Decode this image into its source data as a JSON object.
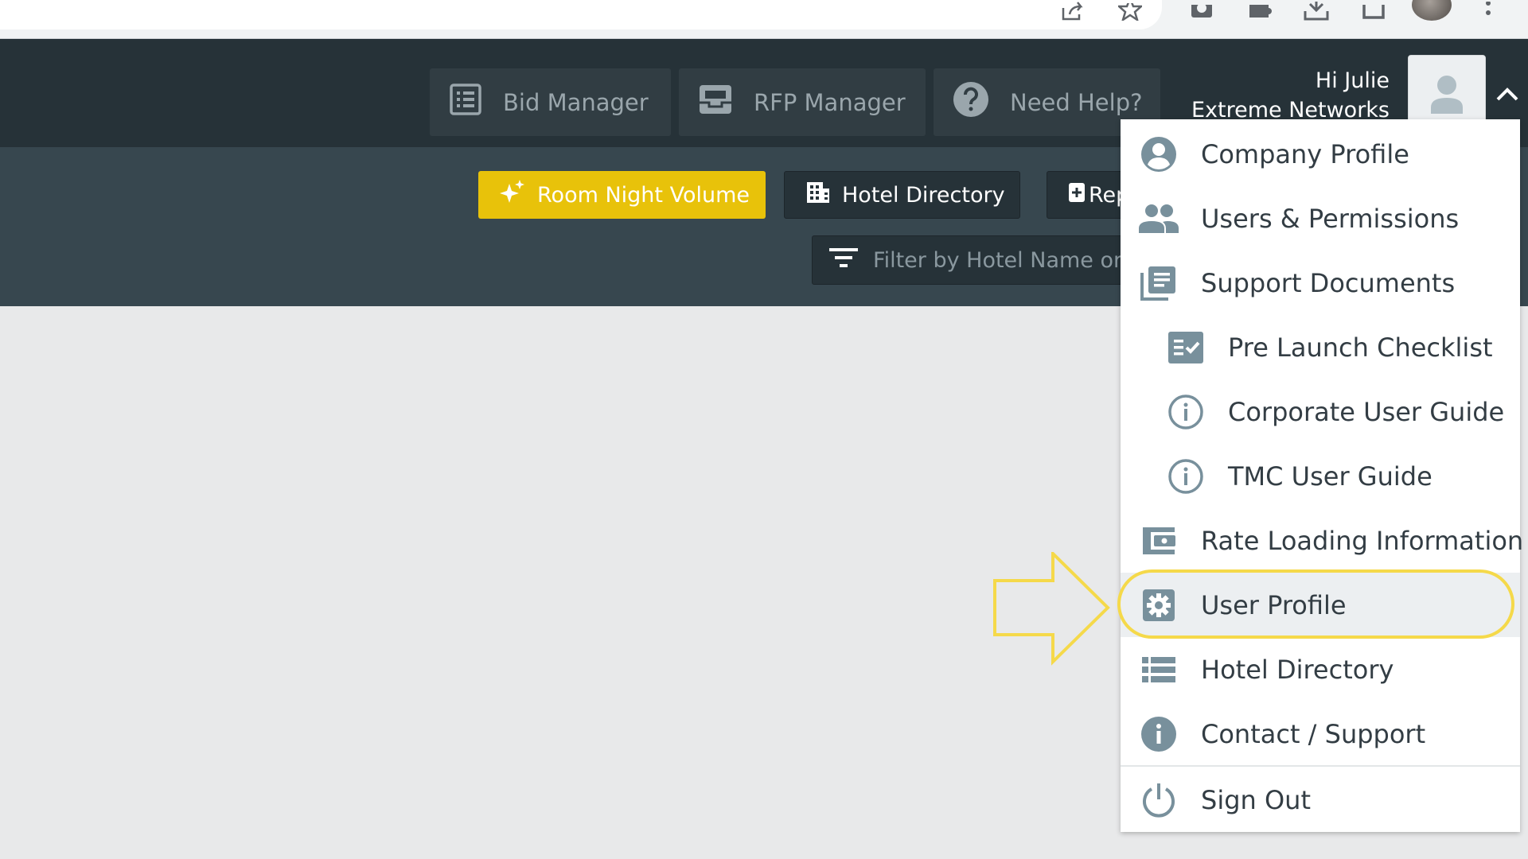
{
  "browser": {
    "icons": [
      "share-icon",
      "star-icon",
      "camera-icon",
      "extensions-icon",
      "download-icon",
      "window-icon",
      "profile-avatar",
      "kebab-menu-icon"
    ]
  },
  "header": {
    "nav": [
      {
        "label": "Bid Manager",
        "icon": "list-icon"
      },
      {
        "label": "RFP Manager",
        "icon": "inbox-icon"
      },
      {
        "label": "Need Help?",
        "icon": "help-circle-icon"
      }
    ],
    "greeting": "Hi Julie",
    "company": "Extreme Networks"
  },
  "toolbar": {
    "room_night_volume": "Room Night Volume",
    "hotel_directory": "Hotel Directory",
    "reports_partial": "Rep",
    "filter_placeholder": "Filter by Hotel Name or S"
  },
  "menu": {
    "items": [
      {
        "label": "Company Profile",
        "icon": "account-circle-icon"
      },
      {
        "label": "Users & Permissions",
        "icon": "people-icon"
      },
      {
        "label": "Support Documents",
        "icon": "library-books-icon"
      },
      {
        "label": "Pre Launch Checklist",
        "icon": "checklist-icon"
      },
      {
        "label": "Corporate User Guide",
        "icon": "info-outline-icon"
      },
      {
        "label": "TMC User Guide",
        "icon": "info-outline-icon"
      },
      {
        "label": "Rate Loading Information",
        "icon": "wallet-icon"
      },
      {
        "label": "User Profile",
        "icon": "gear-icon"
      },
      {
        "label": "Hotel Directory",
        "icon": "list-view-icon"
      },
      {
        "label": "Contact / Support",
        "icon": "info-filled-icon"
      },
      {
        "label": "Sign Out",
        "icon": "power-icon"
      }
    ],
    "highlighted": "User Profile"
  },
  "colors": {
    "header_bg": "#263238",
    "toolbar_bg": "#37474f",
    "accent_yellow": "#e8c20a",
    "highlight": "#f5d94a",
    "icon_gray": "#78909c"
  }
}
